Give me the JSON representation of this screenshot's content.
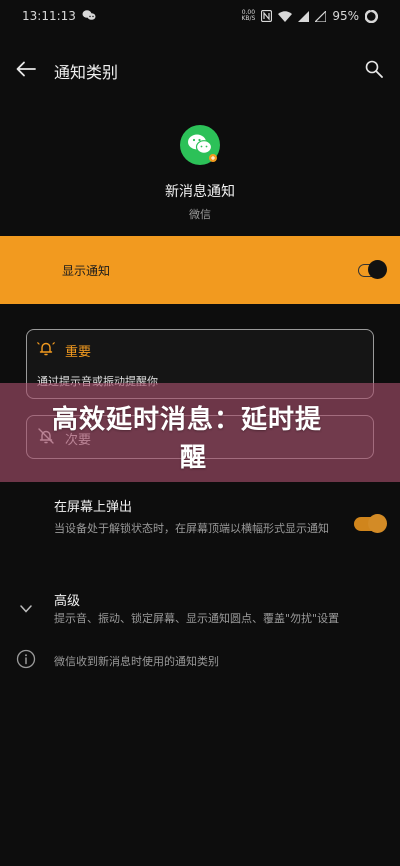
{
  "status_bar": {
    "time": "13:11:13",
    "net_speed_value": "0.00",
    "net_speed_unit": "KB/S",
    "battery": "95%"
  },
  "app_bar": {
    "title": "通知类别",
    "back_icon": "arrow-left-icon",
    "search_icon": "search-icon"
  },
  "header": {
    "title": "新消息通知",
    "subtitle": "微信"
  },
  "show_notification": {
    "label": "显示通知",
    "enabled": true
  },
  "importance_important": {
    "label": "重要",
    "description": "通过提示音或振动提醒你",
    "selected": true
  },
  "importance_silent": {
    "label": "次要"
  },
  "banner": {
    "line1": "高效延时消息：延时提",
    "line2": "醒"
  },
  "popup": {
    "title": "在屏幕上弹出",
    "description": "当设备处于解锁状态时，在屏幕顶端以横幅形式显示通知",
    "enabled": true
  },
  "advanced": {
    "title": "高级",
    "description": "提示音、振动、锁定屏幕、显示通知圆点、覆盖\"勿扰\"设置"
  },
  "info": {
    "text": "微信收到新消息时使用的通知类别"
  },
  "colors": {
    "accent": "#f29a1f",
    "background": "#0d0d0d",
    "banner": "#aa506e"
  }
}
